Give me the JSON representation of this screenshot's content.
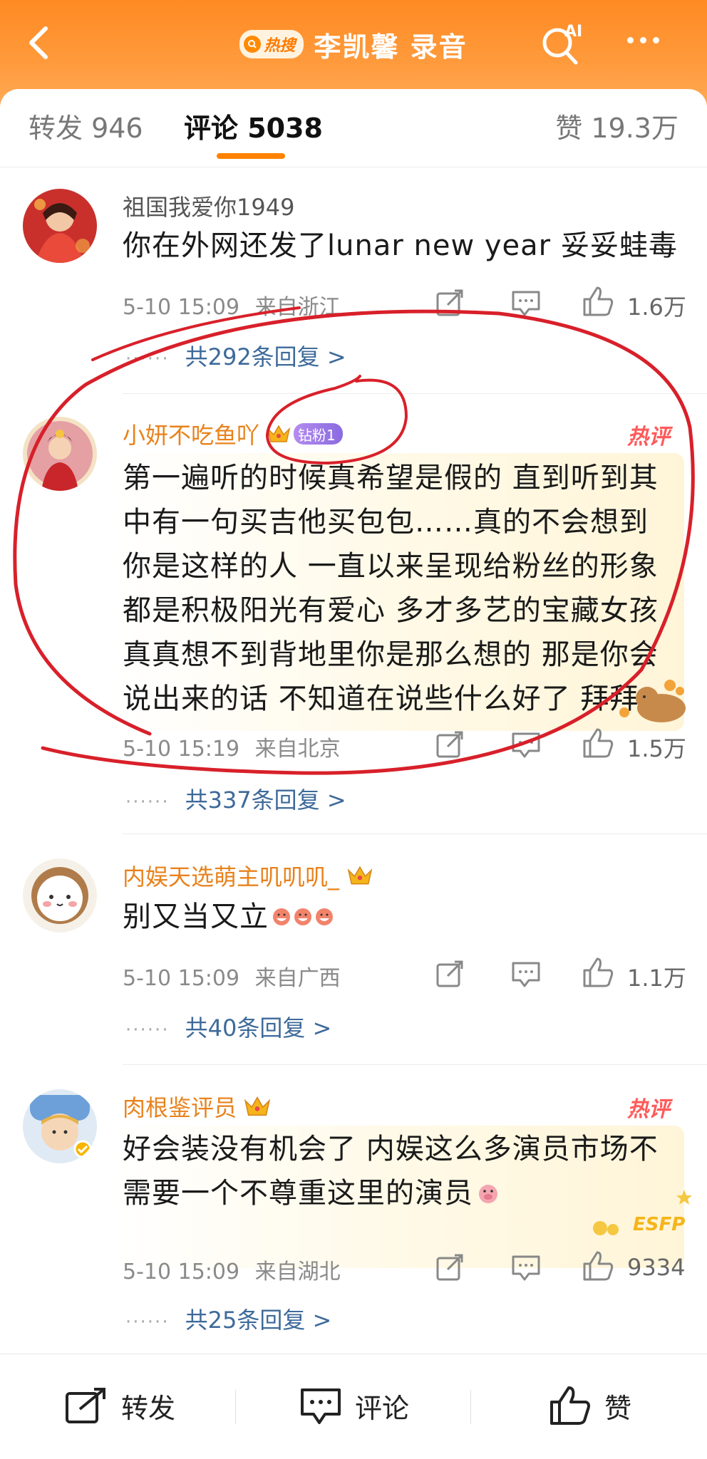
{
  "header": {
    "hot_search_label": "热搜",
    "topic_title": "李凯馨 录音",
    "ai_label": "AI"
  },
  "tabs": {
    "repost": "转发 946",
    "comments": "评论 5038",
    "likes": "赞 19.3万"
  },
  "comments": [
    {
      "username": "祖国我爱你1949",
      "text": "你在外网还发了lunar new year 妥妥蛙毒",
      "time": "5-10 15:09",
      "location": "来自浙江",
      "likes": "1.6万",
      "replies": "共292条回复 >"
    },
    {
      "username": "小妍不吃鱼吖",
      "fan_badge": "钻粉1",
      "hot": "热评",
      "text_lines": [
        "第一遍听的时候真希望是假的 直到听到其",
        "中有一句买吉他买包包……真的不会想到",
        "你是这样的人 一直以来呈现给粉丝的形象",
        "都是积极阳光有爱心 多才多艺的宝藏女孩",
        "真真想不到背地里你是那么想的 那是你会",
        "说出来的话 不知道在说些什么好了 拜拜"
      ],
      "time": "5-10 15:19",
      "location": "来自北京",
      "likes": "1.5万",
      "replies": "共337条回复 >"
    },
    {
      "username": "内娱天选萌主叽叽叽_",
      "text": "别又当又立",
      "time": "5-10 15:09",
      "location": "来自广西",
      "likes": "1.1万",
      "replies": "共40条回复 >"
    },
    {
      "username": "肉根鉴评员",
      "hot": "热评",
      "text_lines": [
        "好会装没有机会了 内娱这么多演员市场不",
        "需要一个不尊重这里的演员"
      ],
      "sticker_text": "ESFP",
      "time": "5-10 15:09",
      "location": "来自湖北",
      "likes": "9334",
      "replies": "共25条回复 >"
    }
  ],
  "bottom_bar": {
    "repost": "转发",
    "comment": "评论",
    "like": "赞"
  },
  "colors": {
    "header_orange": "#ff8a22",
    "accent_orange": "#ff8200",
    "link_blue": "#3e6a9a",
    "annotation_red": "#d8202a"
  }
}
